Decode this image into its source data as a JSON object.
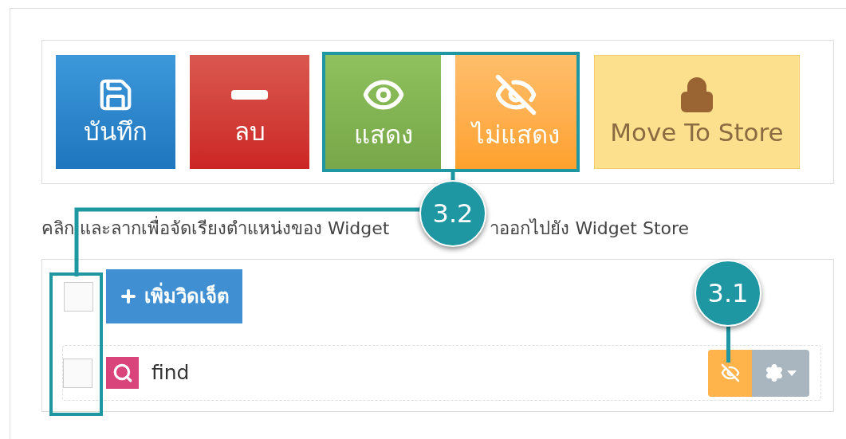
{
  "toolbar": {
    "buttons": [
      {
        "label": "บันทึก",
        "kind": "save"
      },
      {
        "label": "ลบ",
        "kind": "delete"
      },
      {
        "label": "แสดง",
        "kind": "show"
      },
      {
        "label": "ไม่แสดง",
        "kind": "hide"
      },
      {
        "label": "Move To Store",
        "kind": "store"
      }
    ]
  },
  "instruction": [
    "คลิก และลากเพื่อจัดเรียงตำแหน่งของ Widget",
    "าออกไปยัง Widget Store"
  ],
  "widget_list": {
    "select_all_checked": false,
    "add_button": "เพิ่มวิดเจ็ต",
    "rows": [
      {
        "label": "find",
        "checked": false
      }
    ]
  },
  "callouts": [
    {
      "label": "3.2"
    },
    {
      "label": "3.1"
    }
  ]
}
